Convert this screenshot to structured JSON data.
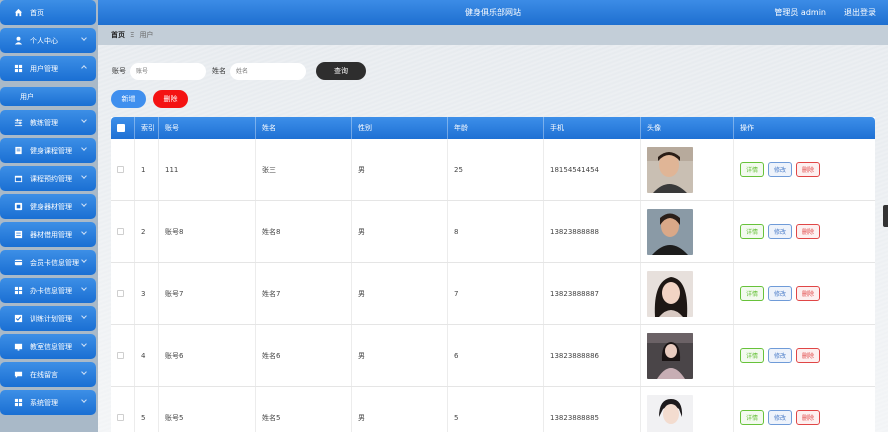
{
  "header": {
    "site_title": "健身俱乐部网站",
    "admin_text": "管理员 admin",
    "logout": "退出登录"
  },
  "sidebar": {
    "items": [
      {
        "label": "首页",
        "icon": "home-icon"
      },
      {
        "label": "个人中心",
        "icon": "user-icon"
      },
      {
        "label": "用户管理",
        "icon": "grid-icon"
      },
      {
        "label": "教练管理",
        "icon": "sliders-icon"
      },
      {
        "label": "健身课程管理",
        "icon": "book-icon"
      },
      {
        "label": "课程预约管理",
        "icon": "calendar-icon"
      },
      {
        "label": "健身器材管理",
        "icon": "dumbbell-icon"
      },
      {
        "label": "器材借用管理",
        "icon": "list-icon"
      },
      {
        "label": "会员卡信息管理",
        "icon": "card-icon"
      },
      {
        "label": "办卡信息管理",
        "icon": "grid-icon"
      },
      {
        "label": "训练计划管理",
        "icon": "plan-icon"
      },
      {
        "label": "教室信息管理",
        "icon": "room-icon"
      },
      {
        "label": "在线留言",
        "icon": "message-icon"
      },
      {
        "label": "系统管理",
        "icon": "grid-icon"
      }
    ],
    "sub_item": "用户"
  },
  "breadcrumb": {
    "home": "首页",
    "separator": "Ξ",
    "current": "用户"
  },
  "search": {
    "account_label": "账号",
    "account_placeholder": "账号",
    "name_label": "姓名",
    "name_placeholder": "姓名",
    "query_button": "查询"
  },
  "actions": {
    "add": "新增",
    "delete": "删除"
  },
  "table": {
    "headers": {
      "index": "索引",
      "account": "账号",
      "name": "姓名",
      "gender": "性别",
      "age": "年龄",
      "phone": "手机",
      "avatar": "头像",
      "ops": "操作"
    },
    "row_buttons": {
      "detail": "详情",
      "edit": "修改",
      "remove": "删除"
    },
    "rows": [
      {
        "index": "1",
        "account": "111",
        "name": "张三",
        "gender": "男",
        "age": "25",
        "phone": "18154541454"
      },
      {
        "index": "2",
        "account": "账号8",
        "name": "姓名8",
        "gender": "男",
        "age": "8",
        "phone": "13823888888"
      },
      {
        "index": "3",
        "account": "账号7",
        "name": "姓名7",
        "gender": "男",
        "age": "7",
        "phone": "13823888887"
      },
      {
        "index": "4",
        "account": "账号6",
        "name": "姓名6",
        "gender": "男",
        "age": "6",
        "phone": "13823888886"
      },
      {
        "index": "5",
        "account": "账号5",
        "name": "姓名5",
        "gender": "男",
        "age": "5",
        "phone": "13823888885"
      }
    ]
  },
  "colors": {
    "primary_blue": "#1e70d4",
    "delete_red": "#f41212",
    "query_dark": "#2e2e2e",
    "detail_green": "#67c23a"
  }
}
